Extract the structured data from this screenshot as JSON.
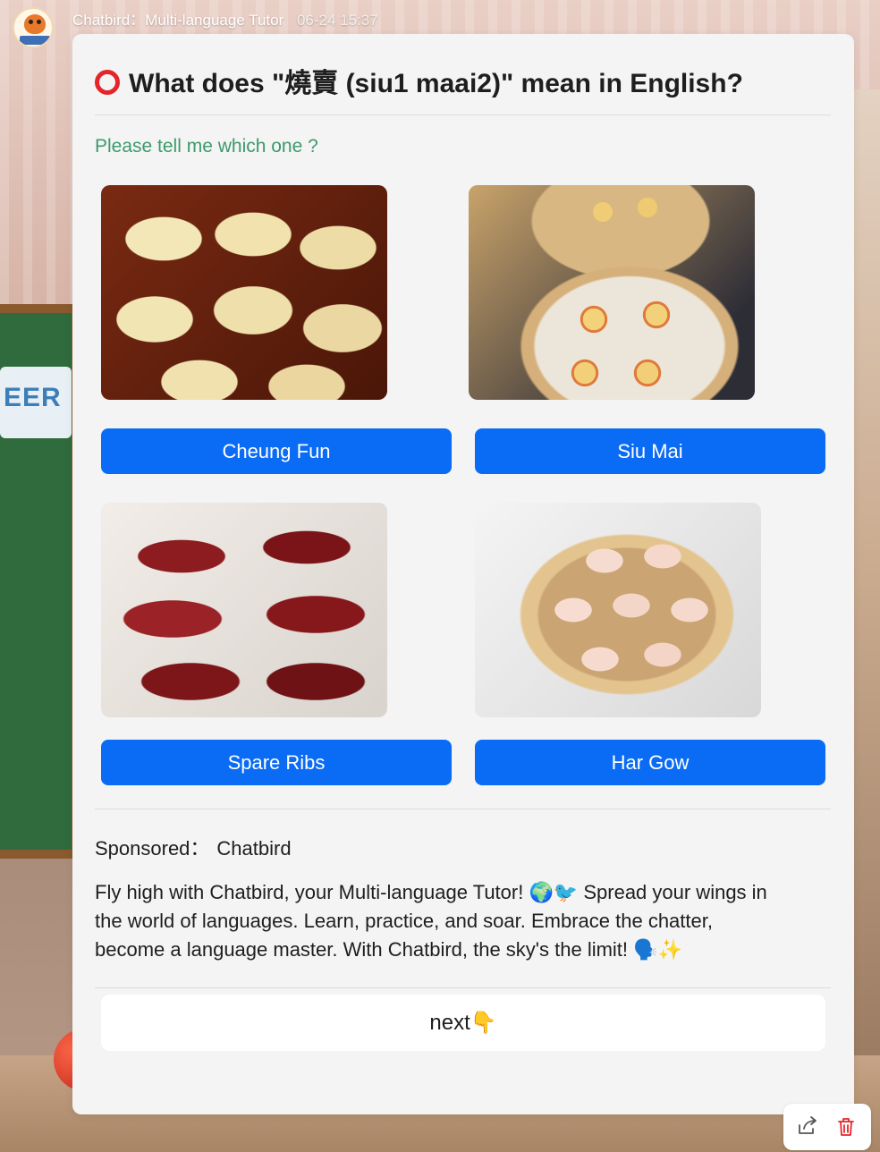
{
  "header": {
    "chat_title": "Chatbird：Multi-language Tutor",
    "timestamp": "06-24 15:37"
  },
  "question": {
    "marker_icon": "red-circle-icon",
    "title": "What does \"燒賣 (siu1 maai2)\" mean in English?",
    "prompt": "Please tell me which one ?"
  },
  "choices": [
    {
      "label": "Cheung Fun",
      "image": "cheung-fun-photo"
    },
    {
      "label": "Siu Mai",
      "image": "siu-mai-photo"
    },
    {
      "label": "Spare Ribs",
      "image": "spare-ribs-photo"
    },
    {
      "label": "Har Gow",
      "image": "har-gow-photo"
    }
  ],
  "sponsor": {
    "label": "Sponsored：",
    "name": "Chatbird",
    "ad_line1": "Fly high with Chatbird, your Multi-language Tutor! 🌍🐦 Spread your wings in",
    "ad_line2": "the world of languages. Learn, practice, and soar. Embrace the chatter,",
    "ad_line3": "become a language master. With Chatbird, the sky's the limit! 🗣️✨"
  },
  "next_button": "next👇",
  "colors": {
    "accent_blue": "#0a6bf4",
    "prompt_green": "#3d9a6c",
    "marker_red": "#e5252a",
    "delete_red": "#e5252a"
  },
  "icons": {
    "share": "share-icon",
    "delete": "trash-icon"
  }
}
